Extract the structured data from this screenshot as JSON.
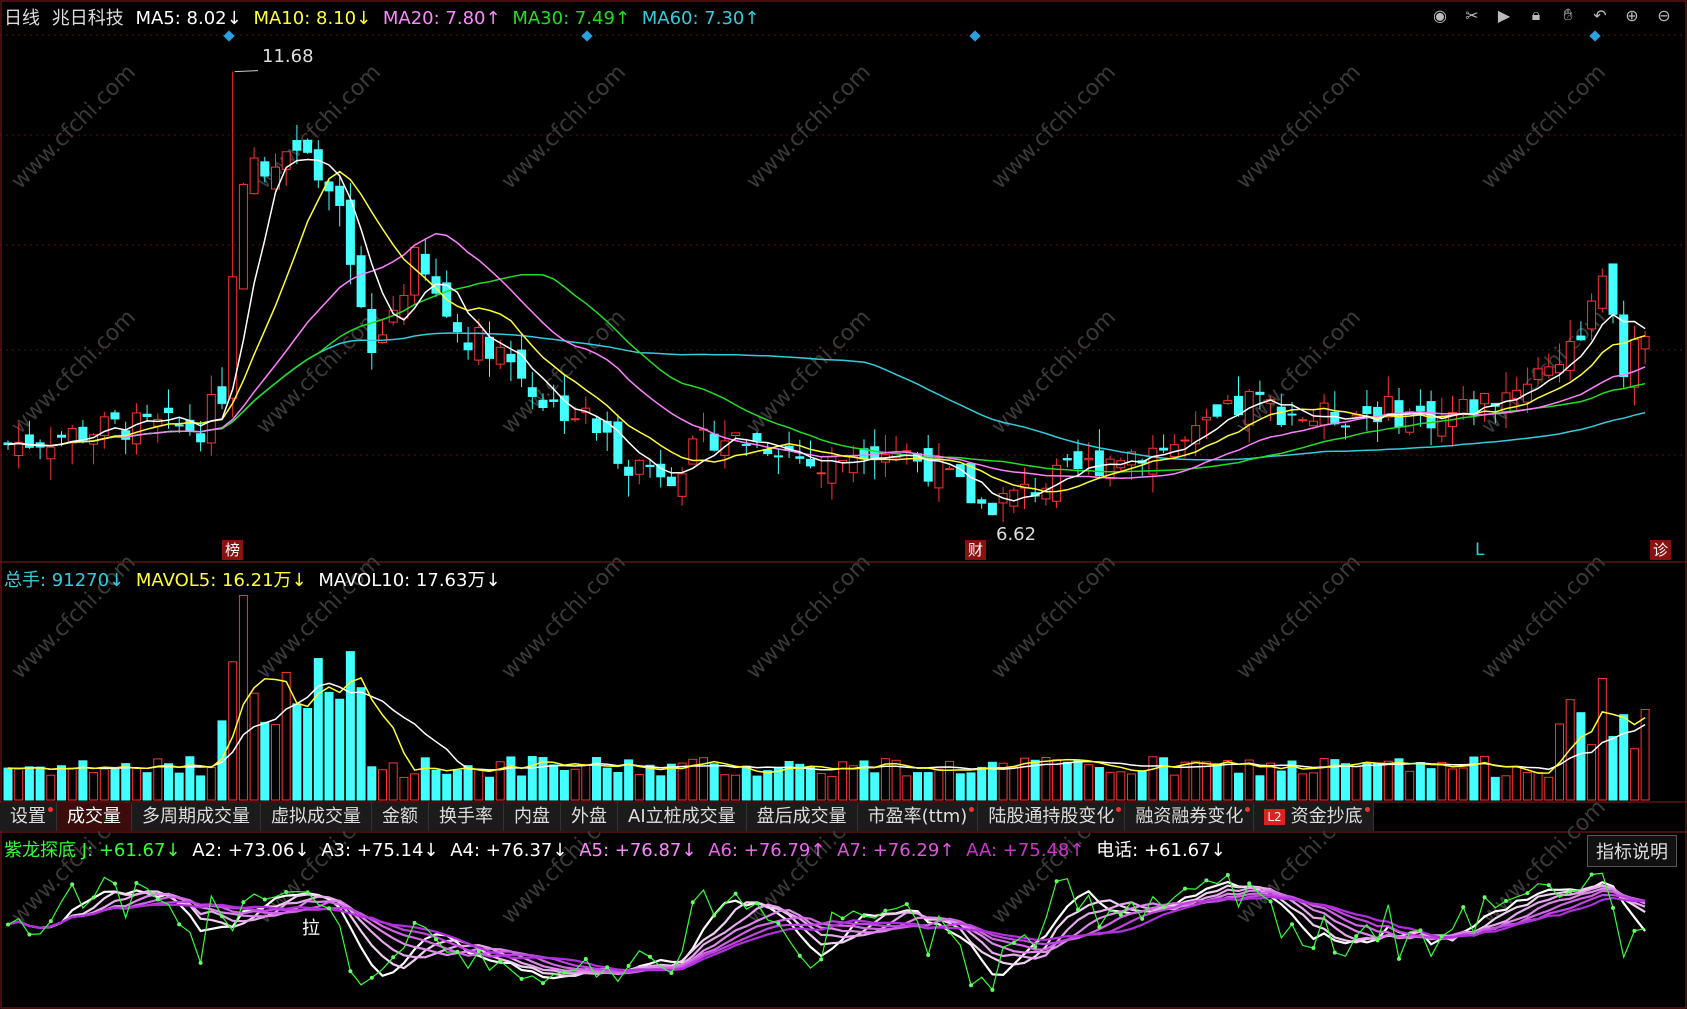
{
  "main_header": {
    "period": "日线",
    "stock_name": "兆日科技",
    "ma5": "MA5: 8.02↓",
    "ma10": "MA10: 8.10↓",
    "ma20": "MA20: 7.80↑",
    "ma30": "MA30: 7.49↑",
    "ma60": "MA60: 7.30↑"
  },
  "colors": {
    "ma5": "#ffffff",
    "ma10": "#ffff33",
    "ma20": "#ff80ff",
    "ma30": "#22dd22",
    "ma60": "#33ccdd",
    "up": "#ff3333",
    "down": "#44ffff",
    "label_cyan": "#44dddd",
    "zilong": "#33ff33"
  },
  "price_labels": {
    "high": "11.68",
    "low": "6.62"
  },
  "markers": {
    "bang": "榜",
    "cai": "财",
    "l": "L",
    "zhen": "诊"
  },
  "volume_header": {
    "total": "总手: 91270↓",
    "mavol5": "MAVOL5: 16.21万↓",
    "mavol10": "MAVOL10: 17.63万↓"
  },
  "tabs": [
    {
      "label": "设置",
      "dot": true
    },
    {
      "label": "成交量",
      "dot": false,
      "active": true
    },
    {
      "label": "多周期成交量",
      "dot": false
    },
    {
      "label": "虚拟成交量",
      "dot": false
    },
    {
      "label": "金额",
      "dot": false
    },
    {
      "label": "换手率",
      "dot": false
    },
    {
      "label": "内盘",
      "dot": false
    },
    {
      "label": "外盘",
      "dot": false
    },
    {
      "label": "AI立桩成交量",
      "dot": false
    },
    {
      "label": "盘后成交量",
      "dot": false
    },
    {
      "label": "市盈率(ttm)",
      "dot": true
    },
    {
      "label": "陆股通持股变化",
      "dot": true
    },
    {
      "label": "融资融券变化",
      "dot": true
    },
    {
      "label": "资金抄底",
      "dot": true,
      "badge": "L2"
    }
  ],
  "indicator_header": {
    "name": "紫龙探底 J: +61.67↓",
    "a2": "A2: +73.06↓",
    "a3": "A3: +75.14↓",
    "a4": "A4: +76.37↓",
    "a5": "A5: +76.87↓",
    "a6": "A6: +76.79↑",
    "a7": "A7: +76.29↑",
    "aa": "AA: +75.48↑",
    "phone": "电话: +61.67↓"
  },
  "indicator_label": "拉",
  "explain_button": "指标说明",
  "watermark": "www.cfchi.com",
  "toolbar_icons": [
    "eye-icon",
    "scissors-icon",
    "play-icon",
    "lock-icon",
    "hand-icon",
    "undo-icon",
    "zoom-in-icon",
    "zoom-out-icon"
  ],
  "chart_data": {
    "type": "candlestick",
    "title": "兆日科技 日线",
    "price_range": [
      6.3,
      12.1
    ],
    "volume_max": 380000,
    "high_point": 11.68,
    "low_point": 6.62,
    "series": [
      {
        "name": "MA5",
        "values": []
      },
      {
        "name": "MA10",
        "values": []
      },
      {
        "name": "MA20",
        "values": []
      },
      {
        "name": "MA30",
        "values": []
      },
      {
        "name": "MA60",
        "values": []
      }
    ]
  }
}
